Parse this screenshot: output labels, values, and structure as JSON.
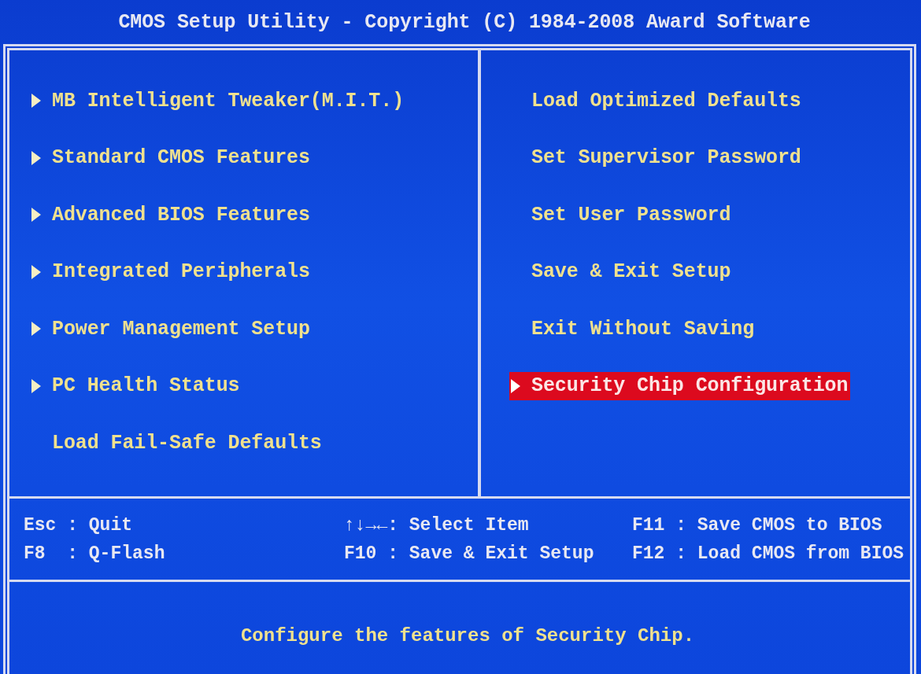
{
  "title": "CMOS Setup Utility - Copyright (C) 1984-2008 Award Software",
  "menu": {
    "left": [
      {
        "label": "MB Intelligent Tweaker(M.I.T.)",
        "submenu": true,
        "selected": false
      },
      {
        "label": "Standard CMOS Features",
        "submenu": true,
        "selected": false
      },
      {
        "label": "Advanced BIOS Features",
        "submenu": true,
        "selected": false
      },
      {
        "label": "Integrated Peripherals",
        "submenu": true,
        "selected": false
      },
      {
        "label": "Power Management Setup",
        "submenu": true,
        "selected": false
      },
      {
        "label": "PC Health Status",
        "submenu": true,
        "selected": false
      },
      {
        "label": "Load Fail-Safe Defaults",
        "submenu": false,
        "selected": false
      }
    ],
    "right": [
      {
        "label": "Load Optimized Defaults",
        "submenu": false,
        "selected": false
      },
      {
        "label": "Set Supervisor Password",
        "submenu": false,
        "selected": false
      },
      {
        "label": "Set User Password",
        "submenu": false,
        "selected": false
      },
      {
        "label": "Save & Exit Setup",
        "submenu": false,
        "selected": false
      },
      {
        "label": "Exit Without Saving",
        "submenu": false,
        "selected": false
      },
      {
        "label": "Security Chip Configuration",
        "submenu": true,
        "selected": true
      }
    ]
  },
  "key_help": [
    "Esc : Quit",
    "↑↓→←: Select Item",
    "F11 : Save CMOS to BIOS",
    "F8  : Q-Flash",
    "F10 : Save & Exit Setup",
    "F12 : Load CMOS from BIOS"
  ],
  "description": "Configure the features of Security Chip."
}
